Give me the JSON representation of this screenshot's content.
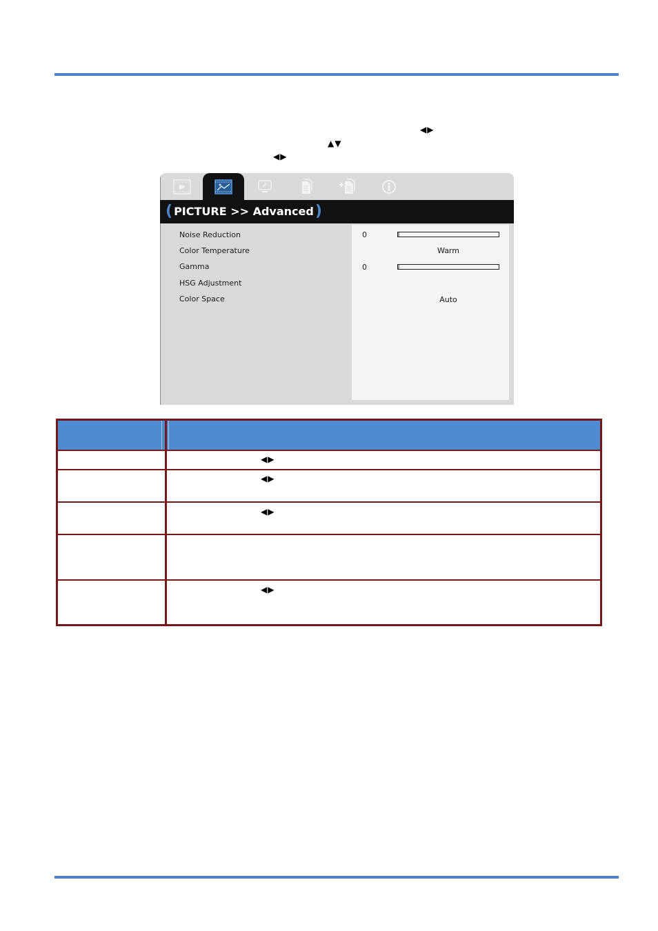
{
  "page": {
    "rule_color": "#4f86c6",
    "instruction_arrows": [
      {
        "name": "left-right-arrows",
        "glyph": "◀▶"
      },
      {
        "name": "up-down-arrows",
        "glyph": "▲▼"
      },
      {
        "name": "left-right-arrows",
        "glyph": "◀▶"
      }
    ]
  },
  "osd": {
    "tabs": [
      {
        "name": "input-tab",
        "icon": "play-film-icon",
        "active": false
      },
      {
        "name": "picture-tab",
        "icon": "picture-film-icon",
        "active": true
      },
      {
        "name": "display-tab",
        "icon": "monitor-icon",
        "active": false
      },
      {
        "name": "setup-tab",
        "icon": "document-icon",
        "active": false
      },
      {
        "name": "advanced-setup-tab",
        "icon": "document-plus-icon",
        "active": false
      },
      {
        "name": "info-tab",
        "icon": "info-icon",
        "active": false
      }
    ],
    "title": {
      "open_paren": "(",
      "text": "PICTURE >> Advanced",
      "close_paren": ")"
    },
    "items": [
      {
        "label": "Noise Reduction",
        "value": "0",
        "control": "slider",
        "level": 0
      },
      {
        "label": "Color Temperature",
        "value": "Warm",
        "control": "text"
      },
      {
        "label": "Gamma",
        "value": "0",
        "control": "slider",
        "level": 0
      },
      {
        "label": "HSG Adjustment",
        "value": "",
        "control": "none"
      },
      {
        "label": "Color Space",
        "value": "Auto",
        "control": "text"
      }
    ],
    "colors": {
      "accent": "#4f86c6",
      "title_bg": "#111111",
      "panel_bg": "#d9d9d9",
      "value_bg": "#f4f4f2"
    }
  },
  "table": {
    "header": [
      "",
      ""
    ],
    "header_color": "#4f8bcf",
    "border_color": "#74161a",
    "rows": [
      {
        "item": "",
        "description": "",
        "arrows": "◀▶"
      },
      {
        "item": "",
        "description": "",
        "arrows": "◀▶"
      },
      {
        "item": "",
        "description": "",
        "arrows": "◀▶"
      },
      {
        "item": "",
        "description": "",
        "arrows": ""
      },
      {
        "item": "",
        "description": "",
        "arrows": "◀▶"
      }
    ]
  }
}
